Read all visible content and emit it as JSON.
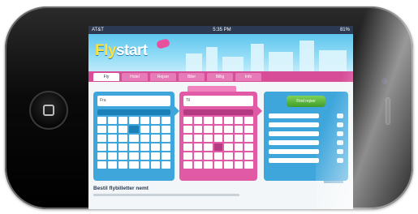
{
  "status_bar": {
    "carrier": "AT&T",
    "time": "5:35 PM",
    "battery": "81%"
  },
  "app": {
    "logo_prefix": "Fly",
    "logo_suffix": "start",
    "heading": "Bestil flybilletter nemt"
  },
  "nav": {
    "tabs": [
      {
        "label": "Fly"
      },
      {
        "label": "Hotel"
      },
      {
        "label": "Rejser"
      },
      {
        "label": "Biler"
      },
      {
        "label": "Billig"
      },
      {
        "label": "Info"
      }
    ]
  },
  "search": {
    "from_value": "Fra",
    "to_value": "Til",
    "submit_label": "Find rejser"
  },
  "colors": {
    "blue_panel": "#3fa6dc",
    "pink_panel": "#e05aa6",
    "search_green": "#4fb030",
    "nav_pink": "#d74d98"
  }
}
